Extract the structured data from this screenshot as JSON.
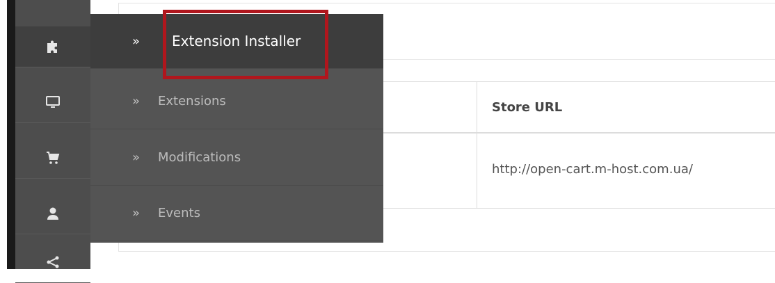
{
  "sidebar": {
    "icons": [
      {
        "name": "puzzle-icon",
        "active": true
      },
      {
        "name": "monitor-icon",
        "active": false
      },
      {
        "name": "cart-icon",
        "active": false
      },
      {
        "name": "user-icon",
        "active": false
      },
      {
        "name": "share-icon",
        "active": false
      }
    ]
  },
  "flyout": {
    "chevron": "»",
    "items": [
      {
        "label": "Extension Installer"
      },
      {
        "label": "Extensions"
      },
      {
        "label": "Modifications"
      },
      {
        "label": "Events"
      }
    ]
  },
  "table": {
    "header": {
      "store_url": "Store URL"
    },
    "rows": [
      {
        "store_url": "http://open-cart.m-host.com.ua/"
      }
    ]
  },
  "colors": {
    "rail": "#4d4d4d",
    "flyout": "#545454",
    "flyout_active": "#3d3d3d",
    "highlight": "#b0161d"
  }
}
